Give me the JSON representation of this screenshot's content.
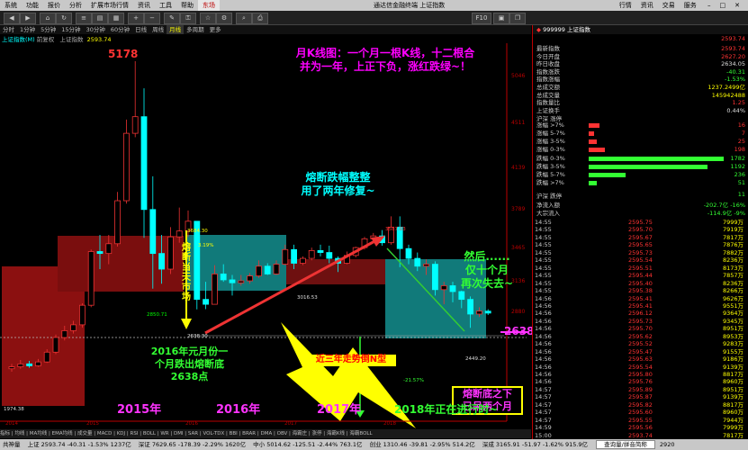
{
  "app": {
    "menus": [
      "系统",
      "功能",
      "报价",
      "分析",
      "扩展市场行情",
      "资讯",
      "工具",
      "帮助",
      "东场"
    ],
    "title": "通达信金融终端 上证指数",
    "right_menus": [
      "行情",
      "资讯",
      "交易",
      "服务"
    ]
  },
  "toolbar": {
    "right_label": "F10"
  },
  "periods": [
    "分时",
    "1分钟",
    "5分钟",
    "15分钟",
    "30分钟",
    "60分钟",
    "日线",
    "周线",
    "月线",
    "多周期",
    "更多"
  ],
  "chart": {
    "info_name": "上证指数(M)",
    "info_mode": "前复权",
    "info_main": "上证指数",
    "info_close": "2593.74",
    "price_labels": [
      "5046",
      "4511",
      "4139",
      "3789",
      "3465",
      "3136",
      "2880"
    ],
    "high_label": "5178",
    "marks": {
      "m3684": "3684.30",
      "m2850": "2850.71",
      "m2638": "2638.30",
      "m3016": "3016.53",
      "m3587": "3587.03",
      "m2449": "2449.20",
      "m1974": "1974.38",
      "m_down": "-21.57%",
      "m_up": "3.19%"
    },
    "annotations": {
      "a1": "月K线图：一个月一根K线，十二根合\n并为一年，上正下负，涨红跌绿~！",
      "a2": "熔断跌幅整整\n用了两年修复~",
      "a3": "2016年元月份一\n个月跌出熔断底\n2638点",
      "a4": "近三年走势倒N型",
      "a5": "然后......\n仅十个月\n再次失去~",
      "a6": "熔断底之下\n已呆两个月",
      "a7": "2638",
      "a8": "熔\n断\n当\n天\n市\n场",
      "y2015": "2015年",
      "y2016": "2016年",
      "y2017": "2017年",
      "y2018": "2018年正在进行时~"
    },
    "tabs": [
      "指标",
      "均线",
      "MA均线",
      "EMA均线",
      "成交量",
      "MACD",
      "KDJ",
      "RSI",
      "BOLL",
      "WR",
      "DMI",
      "SAR",
      "VOL-TDX",
      "BBI",
      "BRAR",
      "DMA",
      "OBV",
      "海霸庄",
      "涨停",
      "海霸K线",
      "海霸BOLL"
    ],
    "year_ticks": [
      "2014",
      "2015",
      "2016",
      "2017",
      "2018"
    ]
  },
  "right": {
    "header_code": "999999",
    "header_name": "上证指数",
    "header_value": "2593.74",
    "quotes": [
      {
        "label": "最新指数",
        "value": "2593.74",
        "color": "#f33"
      },
      {
        "label": "今日开盘",
        "value": "2627.20",
        "color": "#f33"
      },
      {
        "label": "昨日收盘",
        "value": "2634.05",
        "color": "#ddd"
      },
      {
        "label": "指数涨跌",
        "value": "-40.31",
        "color": "#3f3"
      },
      {
        "label": "指数涨幅",
        "value": "-1.53%",
        "color": "#3f3"
      },
      {
        "label": "总成交额",
        "value": "1237.2499亿",
        "color": "#ff0"
      },
      {
        "label": "总成交量",
        "value": "145942488",
        "color": "#ff0"
      },
      {
        "label": "指数量比",
        "value": "1.25",
        "color": "#f33"
      },
      {
        "label": "上证换手",
        "value": "0.44%",
        "color": "#ddd"
      }
    ],
    "updown_title": "沪深 涨停",
    "rise": [
      {
        "label": "涨幅 >7%",
        "value": "16",
        "frac": 0.08
      },
      {
        "label": "涨幅 5-7%",
        "value": "7",
        "frac": 0.04
      },
      {
        "label": "涨幅 3-5%",
        "value": "25",
        "frac": 0.06
      },
      {
        "label": "涨幅 0-3%",
        "value": "198",
        "frac": 0.12
      }
    ],
    "fall": [
      {
        "label": "跌幅 0-3%",
        "value": "1782",
        "frac": 1.0
      },
      {
        "label": "跌幅 3-5%",
        "value": "1192",
        "frac": 0.88
      },
      {
        "label": "跌幅 5-7%",
        "value": "236",
        "frac": 0.27
      },
      {
        "label": "跌幅 >7%",
        "value": "51",
        "frac": 0.06
      }
    ],
    "fall_title": "沪深 跌停",
    "fall_count": "11",
    "flows": [
      {
        "label": "净流入额",
        "value": "-202.7亿  -16%"
      },
      {
        "label": "大宗流入",
        "value": "-114.9亿  -9%"
      }
    ],
    "trades": [
      {
        "t": "14:55",
        "p": "2595.75",
        "v": "7999万"
      },
      {
        "t": "14:55",
        "p": "2595.70",
        "v": "7919万"
      },
      {
        "t": "14:55",
        "p": "2595.67",
        "v": "7817万"
      },
      {
        "t": "14:55",
        "p": "2595.65",
        "v": "7876万"
      },
      {
        "t": "14:55",
        "p": "2595.73",
        "v": "7882万"
      },
      {
        "t": "14:55",
        "p": "2595.54",
        "v": "8236万"
      },
      {
        "t": "14:55",
        "p": "2595.51",
        "v": "8173万"
      },
      {
        "t": "14:55",
        "p": "2595.44",
        "v": "7857万"
      },
      {
        "t": "14:55",
        "p": "2595.40",
        "v": "8236万"
      },
      {
        "t": "14:55",
        "p": "2595.38",
        "v": "8266万"
      },
      {
        "t": "14:56",
        "p": "2595.41",
        "v": "9626万"
      },
      {
        "t": "14:56",
        "p": "2595.41",
        "v": "9551万"
      },
      {
        "t": "14:56",
        "p": "2596.12",
        "v": "9364万"
      },
      {
        "t": "14:56",
        "p": "2595.73",
        "v": "9345万"
      },
      {
        "t": "14:56",
        "p": "2595.70",
        "v": "8951万"
      },
      {
        "t": "14:56",
        "p": "2595.62",
        "v": "8953万"
      },
      {
        "t": "14:56",
        "p": "2595.52",
        "v": "9283万"
      },
      {
        "t": "14:56",
        "p": "2595.47",
        "v": "9155万"
      },
      {
        "t": "14:56",
        "p": "2595.63",
        "v": "9186万"
      },
      {
        "t": "14:56",
        "p": "2595.54",
        "v": "9139万"
      },
      {
        "t": "14:56",
        "p": "2595.80",
        "v": "8817万"
      },
      {
        "t": "14:56",
        "p": "2595.76",
        "v": "8960万"
      },
      {
        "t": "14:57",
        "p": "2595.89",
        "v": "8951万"
      },
      {
        "t": "14:57",
        "p": "2595.87",
        "v": "9139万"
      },
      {
        "t": "14:57",
        "p": "2595.82",
        "v": "8817万"
      },
      {
        "t": "14:57",
        "p": "2595.60",
        "v": "8960万"
      },
      {
        "t": "14:57",
        "p": "2595.55",
        "v": "7944万"
      },
      {
        "t": "14:59",
        "p": "2595.56",
        "v": "7999万"
      },
      {
        "t": "15:00",
        "p": "2593.74",
        "v": "7817万"
      }
    ]
  },
  "statusbar": {
    "s1": "共神量",
    "s2": "上证 2593.74  -40.31  -1.53%  1237亿",
    "s3": "深证 7629.65  -178.39  -2.29%  1620亿",
    "s4": "中小 5014.62  -125.51  -2.44%  763.1亿",
    "s5": "创业 1310.46  -39.81  -2.95%  514.2亿",
    "s6": "深成 3165.91  -51.97  -1.62%  915.9亿",
    "search": "查询量/拼音简称",
    "time": "2920"
  },
  "colors": {
    "up": "#ff3333",
    "down": "#33ff33",
    "accent": "#ffff00",
    "box_red": "#8b1010",
    "box_teal": "#117a7a"
  }
}
